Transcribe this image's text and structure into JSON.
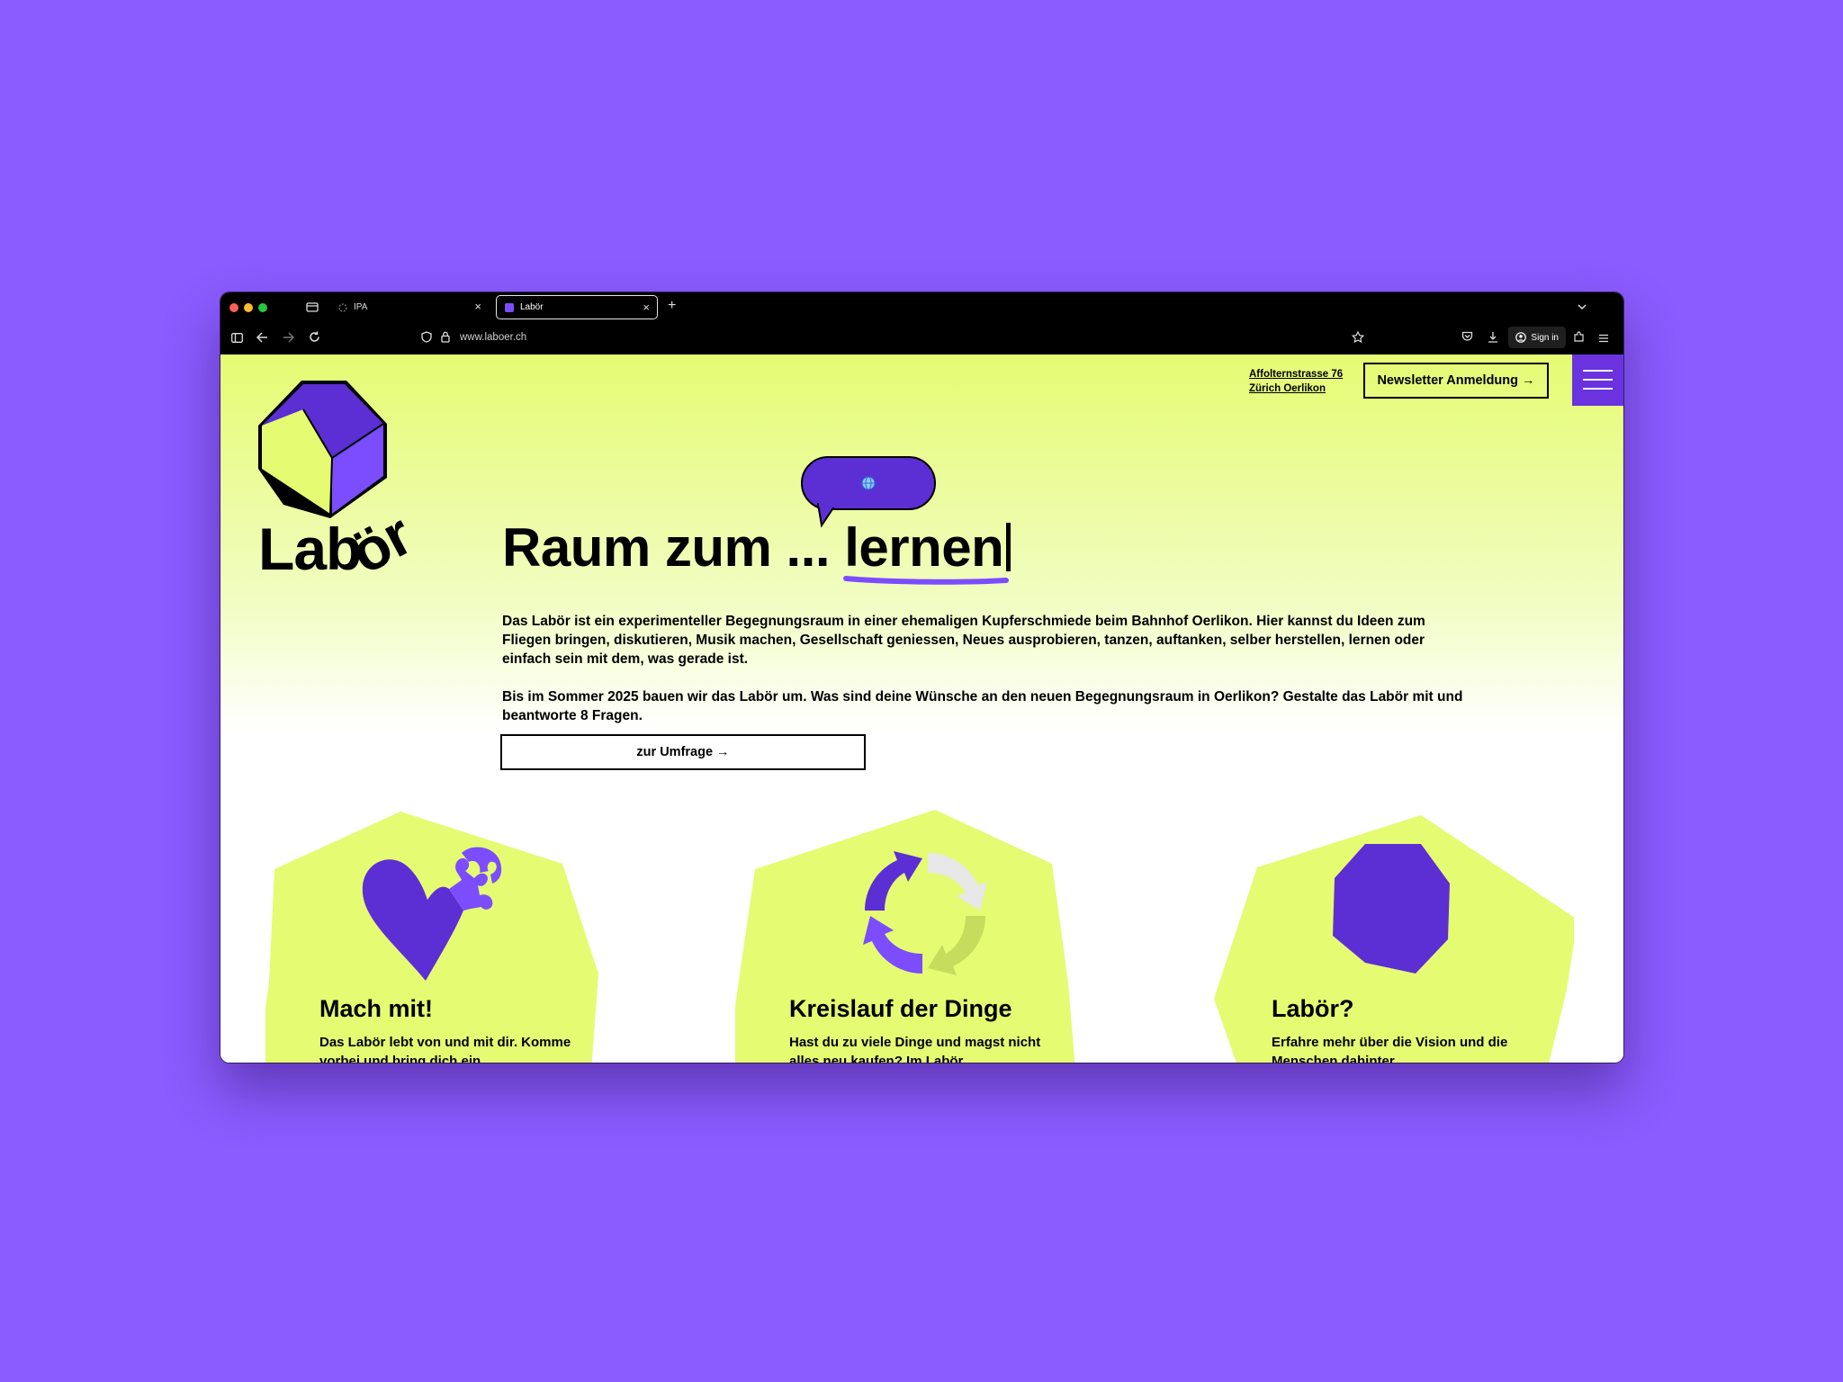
{
  "browser": {
    "tabs": [
      {
        "label": "IPA",
        "active": false
      },
      {
        "label": "Labör",
        "active": true
      }
    ],
    "url": "www.laboer.ch",
    "signin_label": "Sign in",
    "new_tab_label": "+"
  },
  "header": {
    "address_line1": "Affolternstrasse 76",
    "address_line2": "Zürich Oerlikon",
    "newsletter_label": "Newsletter Anmeldung →"
  },
  "logo": {
    "text": "Labör"
  },
  "hero": {
    "headline_prefix": "Raum zum ...",
    "headline_word": "lernen",
    "paragraph1": "Das Labör ist ein experimenteller Begegnungsraum in einer ehemaligen Kupferschmiede beim Bahnhof Oerlikon. Hier kannst du Ideen zum Fliegen bringen, diskutieren, Musik machen, Gesellschaft geniessen, Neues ausprobieren, tanzen, auftanken, selber herstellen, lernen oder einfach sein mit dem, was gerade ist.",
    "paragraph2": "Bis im Sommer 2025 bauen wir das Labör um. Was sind deine Wünsche an den neuen Begegnungsraum in Oerlikon? Gestalte das Labör mit und beantworte 8 Fragen.",
    "survey_label": "zur Umfrage →"
  },
  "cards": [
    {
      "title": "Mach mit!",
      "text": "Das Labör lebt von und mit dir. Komme vorbei und bring dich ein."
    },
    {
      "title": "Kreislauf der Dinge",
      "text": "Hast du zu viele Dinge und magst nicht alles neu kaufen? Im Labör"
    },
    {
      "title": "Labör?",
      "text": "Erfahre mehr über die Vision und die Menschen dahinter."
    }
  ],
  "colors": {
    "background": "#8b5cff",
    "lime": "#e5fb72",
    "purple": "#5a2fd0",
    "light_purple": "#8b5cff"
  }
}
